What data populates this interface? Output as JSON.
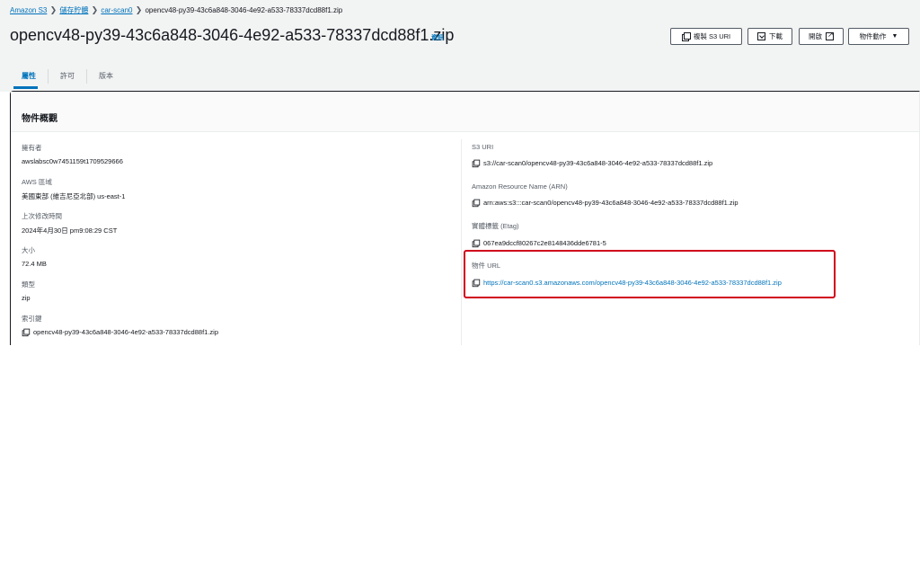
{
  "breadcrumb": {
    "items": [
      "Amazon S3",
      "儲存貯體",
      "car-scan0"
    ],
    "current": "opencv48-py39-43c6a848-3046-4e92-a533-78337dcd88f1.zip",
    "separator": ">"
  },
  "header": {
    "title": "opencv48-py39-43c6a848-3046-4e92-a533-78337dcd88f1.zip",
    "info_link": "資訊"
  },
  "actions": {
    "copy_s3_uri": "複製 S3 URI",
    "download": "下載",
    "open": "開啟",
    "object_actions": "物件動作",
    "dropdown_arrow": "▼"
  },
  "tabs": [
    "屬性",
    "許可",
    "版本"
  ],
  "overview": {
    "title": "物件概觀",
    "left": [
      {
        "label": "擁有者",
        "value": "awslabsc0w7451159t1709529666"
      },
      {
        "label": "AWS 區域",
        "value": "美國東部 (維吉尼亞北部) us-east-1"
      },
      {
        "label": "上次修改時間",
        "value": "2024年4月30日 pm9:08:29 CST"
      },
      {
        "label": "大小",
        "value": "72.4 MB"
      },
      {
        "label": "類型",
        "value": "zip"
      },
      {
        "label": "索引鍵",
        "value": "opencv48-py39-43c6a848-3046-4e92-a533-78337dcd88f1.zip"
      }
    ],
    "right": [
      {
        "label": "S3 URI",
        "value": "s3://car-scan0/opencv48-py39-43c6a848-3046-4e92-a533-78337dcd88f1.zip"
      },
      {
        "label": "Amazon Resource Name (ARN)",
        "value": "arn:aws:s3:::car-scan0/opencv48-py39-43c6a848-3046-4e92-a533-78337dcd88f1.zip"
      },
      {
        "label": "實體標籤 (Etag)",
        "value": "067ea9dccf80267c2e8148436dde6781-5"
      },
      {
        "label": "物件 URL",
        "value": "https://car-scan0.s3.amazonaws.com/opencv48-py39-43c6a848-3046-4e92-a533-78337dcd88f1.zip"
      }
    ]
  },
  "colors": {
    "link": "#0073bb",
    "highlight": "#d0021b",
    "background": "#f2f3f3"
  }
}
